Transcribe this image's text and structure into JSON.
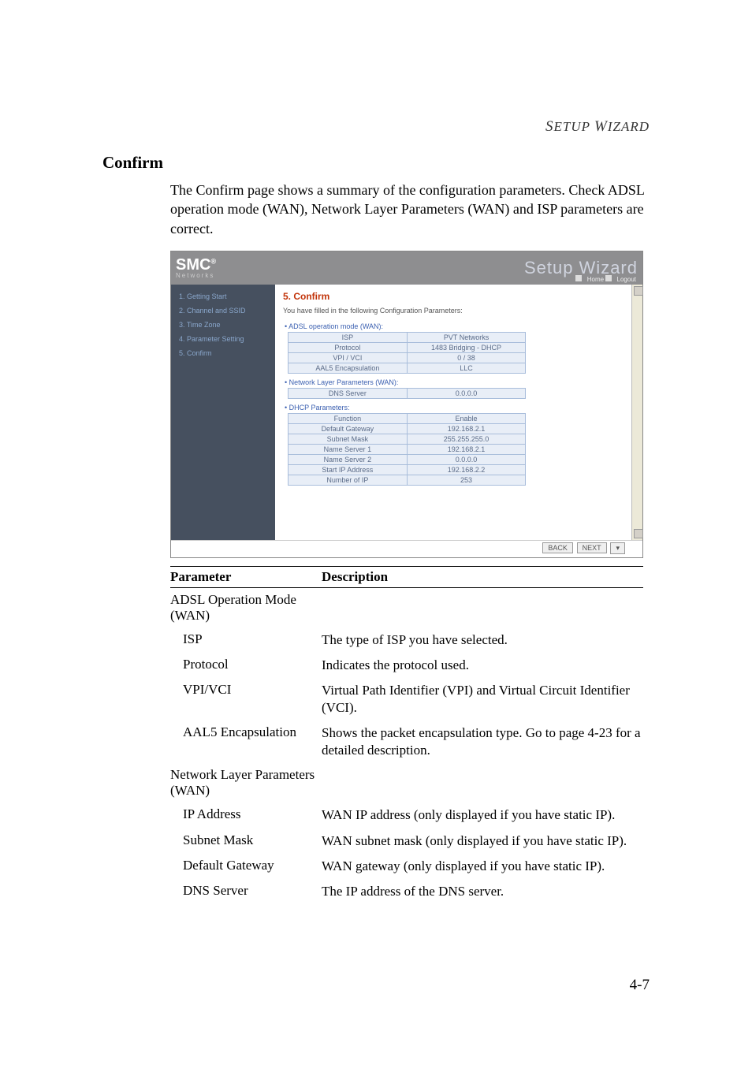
{
  "header": "SETUP WIZARD",
  "title": "Confirm",
  "intro": "The Confirm page shows a summary of the configuration parameters. Check ADSL operation mode (WAN), Network Layer Parameters (WAN) and ISP parameters are correct.",
  "shot": {
    "logo": "SMC",
    "logo_sub": "Networks",
    "brand": "Setup Wizard",
    "brand_links": {
      "home": "Home",
      "logout": "Logout"
    },
    "sidebar": [
      "1. Getting Start",
      "2. Channel and SSID",
      "3. Time Zone",
      "4. Parameter Setting",
      "5. Confirm"
    ],
    "h": "5. Confirm",
    "note": "You have filled in the following Configuration Parameters:",
    "groups": [
      {
        "caption": "ADSL operation mode (WAN):",
        "rows": [
          [
            "ISP",
            "PVT Networks"
          ],
          [
            "Protocol",
            "1483 Bridging - DHCP"
          ],
          [
            "VPI / VCI",
            "0 / 38"
          ],
          [
            "AAL5 Encapsulation",
            "LLC"
          ]
        ]
      },
      {
        "caption": "Network Layer Parameters (WAN):",
        "rows": [
          [
            "DNS Server",
            "0.0.0.0"
          ]
        ]
      },
      {
        "caption": "DHCP Parameters:",
        "rows": [
          [
            "Function",
            "Enable"
          ],
          [
            "Default Gateway",
            "192.168.2.1"
          ],
          [
            "Subnet Mask",
            "255.255.255.0"
          ],
          [
            "Name Server 1",
            "192.168.2.1"
          ],
          [
            "Name Server 2",
            "0.0.0.0"
          ],
          [
            "Start IP Address",
            "192.168.2.2"
          ],
          [
            "Number of IP",
            "253"
          ]
        ]
      }
    ],
    "buttons": {
      "back": "BACK",
      "next": "NEXT"
    }
  },
  "table": {
    "h1": "Parameter",
    "h2": "Description",
    "rows": [
      {
        "group": true,
        "p": "ADSL Operation Mode (WAN)",
        "d": ""
      },
      {
        "indent": true,
        "p": "ISP",
        "d": "The type of ISP you have selected."
      },
      {
        "indent": true,
        "p": "Protocol",
        "d": "Indicates the protocol used."
      },
      {
        "indent": true,
        "p": "VPI/VCI",
        "d": "Virtual Path Identifier (VPI) and Virtual Circuit Identifier (VCI)."
      },
      {
        "indent": true,
        "p": "AAL5 Encapsulation",
        "d": "Shows the packet encapsulation type. Go to  page 4-23 for a detailed description."
      },
      {
        "group": true,
        "p": "Network Layer Parameters (WAN)",
        "d": ""
      },
      {
        "indent": true,
        "p": "IP Address",
        "d": "WAN IP address (only displayed if you have static IP)."
      },
      {
        "indent": true,
        "p": "Subnet Mask",
        "d": "WAN subnet mask (only displayed if you have static IP)."
      },
      {
        "indent": true,
        "p": "Default Gateway",
        "d": "WAN gateway (only displayed if you have static IP)."
      },
      {
        "indent": true,
        "p": "DNS Server",
        "d": "The IP address of the DNS server."
      }
    ]
  },
  "pagenum": "4-7"
}
